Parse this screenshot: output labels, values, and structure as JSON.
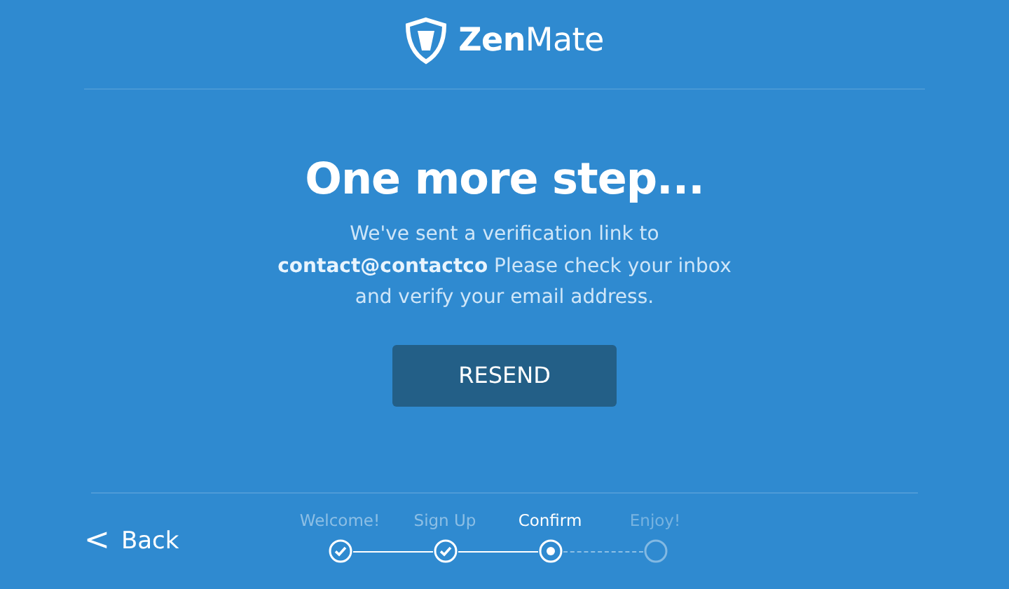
{
  "logo": {
    "text": "**Zen**Mate"
  },
  "heading": "One more step...",
  "message": "We've sent a verification link to **contact@contactco** Please check your inbox and verify your email address.",
  "resend_button": "RESEND",
  "back_button": {
    "icon": "<",
    "label": "Back"
  },
  "steps": [
    {
      "label": "Welcome!",
      "kind": "done"
    },
    {
      "label": "Sign Up",
      "kind": "done"
    },
    {
      "label": "Confirm",
      "kind": "current"
    },
    {
      "label": "Enjoy!",
      "kind": "upcoming"
    }
  ]
}
